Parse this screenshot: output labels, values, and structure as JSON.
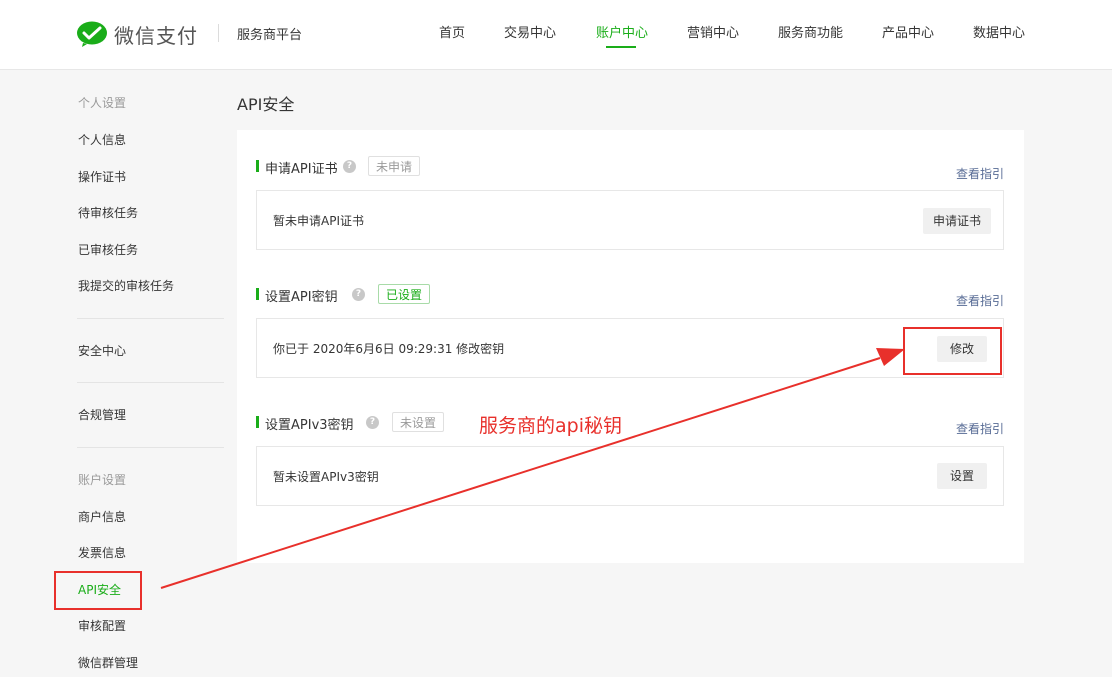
{
  "header": {
    "logo_text": "微信支付",
    "platform": "服务商平台",
    "nav": [
      "首页",
      "交易中心",
      "账户中心",
      "营销中心",
      "服务商功能",
      "产品中心",
      "数据中心"
    ],
    "active_nav": "账户中心"
  },
  "sidebar": {
    "cat_personal": "个人设置",
    "items_personal": [
      "个人信息",
      "操作证书",
      "待审核任务",
      "已审核任务",
      "我提交的审核任务"
    ],
    "security": "安全中心",
    "compliance": "合规管理",
    "cat_account": "账户设置",
    "items_account": [
      "商户信息",
      "发票信息",
      "API安全",
      "审核配置",
      "微信群管理"
    ]
  },
  "main": {
    "title": "API安全",
    "sections": [
      {
        "title": "申请API证书",
        "status": "未申请",
        "guide": "查看指引",
        "text": "暂未申请API证书",
        "button": "申请证书"
      },
      {
        "title": "设置API密钥",
        "status": "已设置",
        "guide": "查看指引",
        "text": "你已于 2020年6月6日 09:29:31 修改密钥",
        "button": "修改"
      },
      {
        "title": "设置APIv3密钥",
        "status": "未设置",
        "guide": "查看指引",
        "text": "暂未设置APIv3密钥",
        "button": "设置"
      }
    ]
  },
  "annotation": {
    "text": "服务商的api秘钥",
    "color": "#e8302b"
  },
  "colors": {
    "brand_green": "#1aad19",
    "link_blue": "#576b95"
  }
}
